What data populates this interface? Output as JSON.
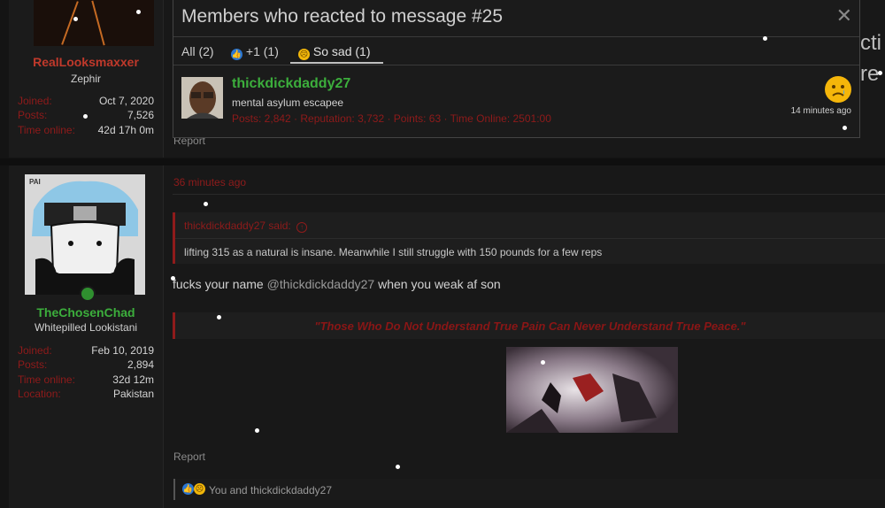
{
  "post1": {
    "username": "RealLooksmaxxer",
    "user_title": "Zephir",
    "stats": [
      {
        "label": "Joined:",
        "value": "Oct 7, 2020"
      },
      {
        "label": "Posts:",
        "value": "7,526"
      },
      {
        "label": "Time online:",
        "value": "42d 17h 0m"
      }
    ],
    "report_label": "Report",
    "bg_text_1": "cti",
    "bg_text_2": "re"
  },
  "post2": {
    "username": "TheChosenChad",
    "user_title": "Whitepilled Lookistani",
    "stats": [
      {
        "label": "Joined:",
        "value": "Feb 10, 2019"
      },
      {
        "label": "Posts:",
        "value": "2,894"
      },
      {
        "label": "Time online:",
        "value": "32d 12m"
      },
      {
        "label": "Location:",
        "value": "Pakistan"
      }
    ],
    "timestamp": "36 minutes ago",
    "quote_header": "thickdickdaddy27 said:",
    "quote_body": "lifting 315 as a natural is insane. Meanwhile I still struggle with 150 pounds for a few reps",
    "message_start": "fucks your name",
    "message_mention": "@thickdickdaddy27",
    "message_end": "when you weak af son",
    "signature": "\"Those Who Do Not Understand True Pain Can Never Understand True Peace.\"",
    "report_label": "Report",
    "reactions_text": "You and thickdickdaddy27",
    "avatar_text": "PAI"
  },
  "modal": {
    "title": "Members who reacted to message #25",
    "close_glyph": "✕",
    "tabs": [
      {
        "label": "All (2)"
      },
      {
        "label": "+1 (1)"
      },
      {
        "label": "So sad (1)"
      }
    ],
    "reactor": {
      "username": "thickdickdaddy27",
      "user_title": "mental asylum escapee",
      "stats": "Posts: 2,842 · Reputation: 3,732 · Points: 63 · Time Online: 2501:00",
      "time": "14 minutes ago"
    }
  },
  "colors": {
    "accent_red": "#8f1b1b",
    "username_red": "#c0392b",
    "username_green": "#3cae3c",
    "background": "#141414"
  }
}
